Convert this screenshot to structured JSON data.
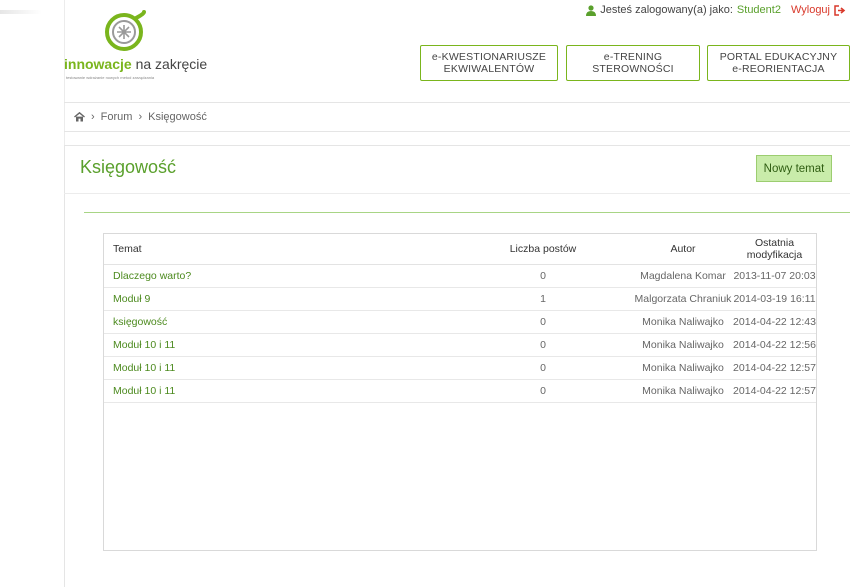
{
  "header": {
    "logo_brand": "innowacje",
    "logo_rest": " na zakręcie",
    "logo_sub": "testowanie wdrażanie nowych metod zarządzania",
    "user_prefix": "Jesteś zalogowany(a) jako:",
    "username": "Student2",
    "logout_label": "Wyloguj",
    "nav": [
      {
        "line1": "e-KWESTIONARIUSZE",
        "line2": "EKWIWALENTÓW"
      },
      {
        "line1": "e-TRENING",
        "line2": "STEROWNOŚCI"
      },
      {
        "line1": "PORTAL EDUKACYJNY",
        "line2": "e-REORIENTACJA"
      }
    ]
  },
  "breadcrumb": {
    "forum": "Forum",
    "current": "Księgowość",
    "sep": "›"
  },
  "page": {
    "title": "Księgowość",
    "new_topic_label": "Nowy temat"
  },
  "table": {
    "headers": {
      "topic": "Temat",
      "posts": "Liczba postów",
      "author": "Autor",
      "modified": "Ostatnia modyfikacja"
    },
    "rows": [
      {
        "topic": "Dlaczego warto?",
        "posts": "0",
        "author": "Magdalena Komar",
        "modified": "2013-11-07 20:03"
      },
      {
        "topic": "Moduł 9",
        "posts": "1",
        "author": "Malgorzata Chraniuk",
        "modified": "2014-03-19 16:11"
      },
      {
        "topic": "księgowość",
        "posts": "0",
        "author": "Monika Naliwajko",
        "modified": "2014-04-22 12:43"
      },
      {
        "topic": "Moduł 10 i 11",
        "posts": "0",
        "author": "Monika Naliwajko",
        "modified": "2014-04-22 12:56"
      },
      {
        "topic": "Moduł 10 i 11",
        "posts": "0",
        "author": "Monika Naliwajko",
        "modified": "2014-04-22 12:57"
      },
      {
        "topic": "Moduł 10 i 11",
        "posts": "0",
        "author": "Monika Naliwajko",
        "modified": "2014-04-22 12:57"
      }
    ]
  },
  "colors": {
    "accent": "#7ab51d",
    "button_bg": "#c9ecaa",
    "logout": "#d9392b"
  },
  "icons": [
    "logo-icon",
    "user-icon",
    "logout-icon",
    "home-icon"
  ]
}
